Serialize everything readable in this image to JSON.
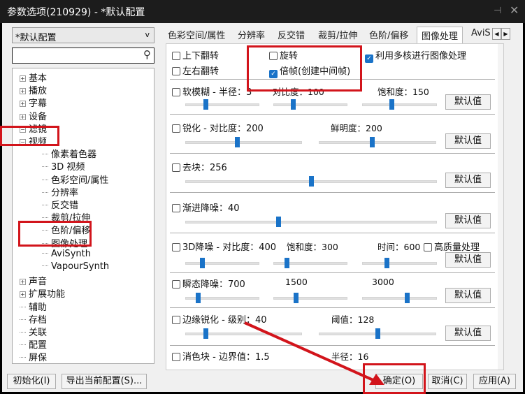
{
  "window": {
    "title": "参数选项(210929) - *默认配置",
    "pin_icon": "pin-icon",
    "close_icon": "close-icon"
  },
  "profile_select": {
    "value": "*默认配置"
  },
  "search": {
    "placeholder": "",
    "value": ""
  },
  "tree": [
    {
      "label": "基本",
      "expander": "+",
      "level": 0
    },
    {
      "label": "播放",
      "expander": "+",
      "level": 0
    },
    {
      "label": "字幕",
      "expander": "+",
      "level": 0
    },
    {
      "label": "设备",
      "expander": "+",
      "level": 0
    },
    {
      "label": "滤镜",
      "expander": "-",
      "level": 0
    },
    {
      "label": "视频",
      "expander": "-",
      "level": 0
    },
    {
      "label": "像素着色器",
      "level": 1
    },
    {
      "label": "3D 视频",
      "level": 1
    },
    {
      "label": "色彩空间/属性",
      "level": 1
    },
    {
      "label": "分辨率",
      "level": 1
    },
    {
      "label": "反交错",
      "level": 1
    },
    {
      "label": "裁剪/拉伸",
      "level": 1
    },
    {
      "label": "色阶/偏移",
      "level": 1
    },
    {
      "label": "图像处理",
      "level": 1
    },
    {
      "label": "AviSynth",
      "level": 1
    },
    {
      "label": "VapourSynth",
      "level": 1
    },
    {
      "label": "声音",
      "expander": "+",
      "level": 0
    },
    {
      "label": "扩展功能",
      "expander": "+",
      "level": 0
    },
    {
      "label": "辅助",
      "level": 0
    },
    {
      "label": "存档",
      "level": 0
    },
    {
      "label": "关联",
      "level": 0
    },
    {
      "label": "配置",
      "level": 0
    },
    {
      "label": "屏保",
      "level": 0
    }
  ],
  "tabs": [
    "色彩空间/属性",
    "分辨率",
    "反交错",
    "裁剪/拉伸",
    "色阶/偏移",
    "图像处理",
    "AviS"
  ],
  "selected_tab": "图像处理",
  "options": {
    "flip_v": {
      "label": "上下翻转",
      "checked": false
    },
    "flip_h": {
      "label": "左右翻转",
      "checked": false
    },
    "rotate": {
      "label": "旋转",
      "checked": false
    },
    "double_frame": {
      "label": "倍帧(创建中间帧)",
      "checked": true
    },
    "multicore": {
      "label": "利用多核进行图像处理",
      "checked": true
    }
  },
  "sections": {
    "soft_blur": {
      "label": "软模糊 - 半径：3",
      "checked": false,
      "l2": "对比度：100",
      "l3": "饱和度：150",
      "sliders": [
        0.27,
        0.26,
        0.39
      ]
    },
    "sharpen": {
      "label": "锐化 - 对比度：200",
      "checked": false,
      "l2": "鲜明度：200",
      "sliders": [
        0.44,
        0.45
      ]
    },
    "deblock": {
      "label": "去块：256",
      "checked": false,
      "sliders": [
        0.5
      ]
    },
    "gradual_denoise": {
      "label": "渐进降噪：40",
      "checked": false,
      "sliders": [
        0.37
      ]
    },
    "denoise3d": {
      "label": "3D降噪 - 对比度：400",
      "checked": false,
      "l2": "饱和度：300",
      "l3": "时间：600",
      "hq": {
        "label": "高质量处理",
        "checked": false
      },
      "sliders": [
        0.22,
        0.17,
        0.32
      ]
    },
    "transient": {
      "label": "瞬态降噪：700",
      "checked": false,
      "l2": "1500",
      "l3": "3000",
      "sliders": [
        0.16,
        0.3,
        0.6
      ]
    },
    "edge_sharpen": {
      "label": "边缘锐化 - 级别：40",
      "checked": false,
      "l2": "阈值：128",
      "sliders": [
        0.17,
        0.5
      ]
    },
    "chroma_deblock": {
      "label": "消色块 - 边界值：1.5",
      "checked": false,
      "l2": "半径：16"
    }
  },
  "default_button": "默认值",
  "buttons": {
    "init": "初始化(I)",
    "export": "导出当前配置(S)...",
    "ok": "确定(O)",
    "cancel": "取消(C)",
    "apply": "应用(A)"
  },
  "annotation_color": "#d2141b"
}
